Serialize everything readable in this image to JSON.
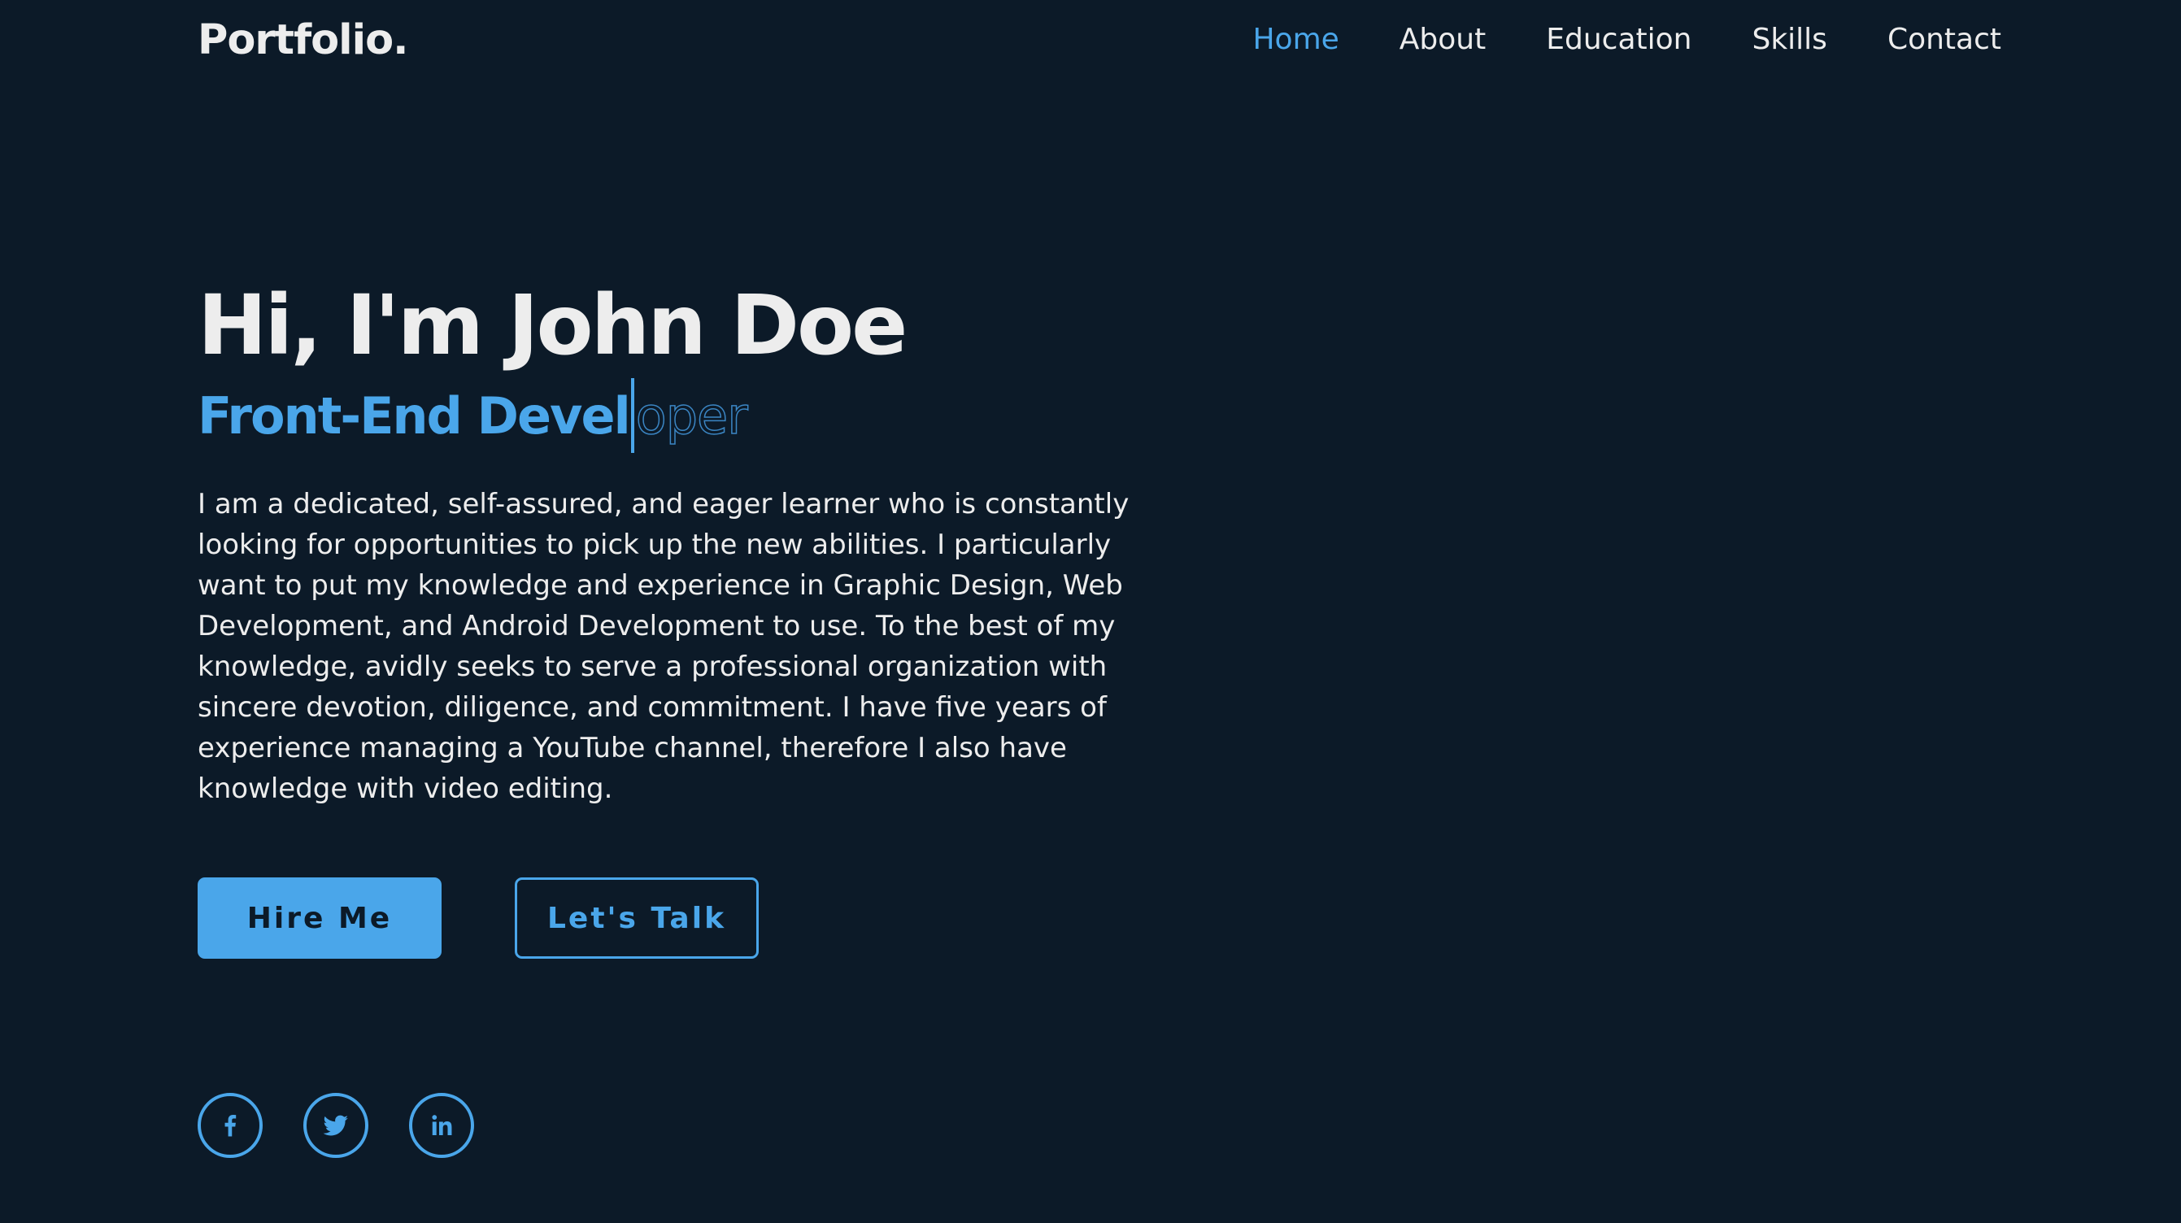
{
  "header": {
    "logo": "Portfolio.",
    "nav": [
      {
        "label": "Home",
        "active": true
      },
      {
        "label": "About",
        "active": false
      },
      {
        "label": "Education",
        "active": false
      },
      {
        "label": "Skills",
        "active": false
      },
      {
        "label": "Contact",
        "active": false
      }
    ]
  },
  "hero": {
    "greeting": "Hi, I'm John Doe",
    "role_typed": "Front-End Devel",
    "role_remaining": "oper",
    "description": "I am a dedicated, self-assured, and eager learner who is constantly looking for opportunities to pick up the new abilities. I particularly want to put my knowledge and experience in Graphic Design, Web Development, and Android Development to use. To the best of my knowledge, avidly seeks to serve a professional organization with sincere devotion, diligence, and commitment. I have five years of experience managing a YouTube channel, therefore I also have knowledge with video editing.",
    "primary_button": "Hire Me",
    "secondary_button": "Let's Talk"
  },
  "socials": [
    {
      "icon": "facebook-icon"
    },
    {
      "icon": "twitter-icon"
    },
    {
      "icon": "linkedin-icon"
    }
  ],
  "colors": {
    "background": "#0c1a28",
    "accent": "#4aa6ea",
    "text": "#ededed"
  }
}
